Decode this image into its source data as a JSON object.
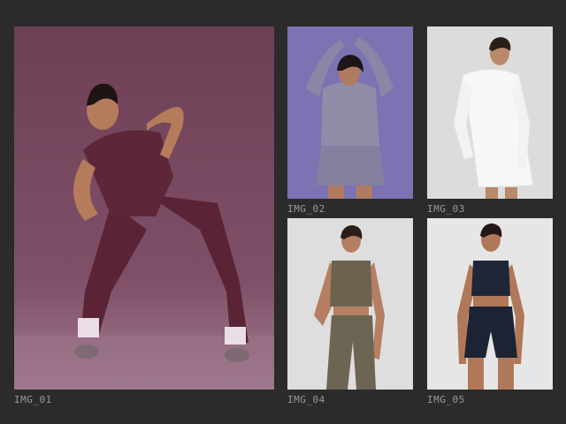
{
  "gallery": {
    "items": [
      {
        "caption": "IMG_01",
        "subject": "woman-in-plum-unitard",
        "bg_color": "#7a4e62"
      },
      {
        "caption": "IMG_02",
        "subject": "woman-in-lavender-zip-top-and-skort",
        "bg_color": "#7b73b2"
      },
      {
        "caption": "IMG_03",
        "subject": "woman-in-white-tennis-dress",
        "bg_color": "#dcdcdc"
      },
      {
        "caption": "IMG_04",
        "subject": "woman-in-olive-bra-and-flare-pants",
        "bg_color": "#dedede"
      },
      {
        "caption": "IMG_05",
        "subject": "woman-in-navy-bra-and-bike-shorts",
        "bg_color": "#e6e6e6"
      }
    ]
  }
}
